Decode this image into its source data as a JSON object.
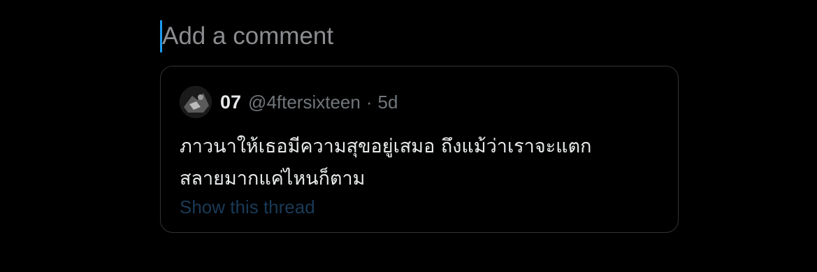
{
  "compose": {
    "placeholder": "Add a comment",
    "caret_color": "#1d9bf0"
  },
  "quote": {
    "avatar_icon": "user-avatar",
    "display_name": "07",
    "handle": "@4ftersixteen",
    "separator": "·",
    "time": "5d",
    "text_line1": "ภาวนาให้เธอมีความสุขอยู่เสมอ ถึงแม้ว่าเราจะแตก",
    "text_line2": "สลายมากแค่ไหนก็ตาม",
    "show_thread": "Show this thread",
    "colors": {
      "background": "#000000",
      "border": "#2f3336",
      "text": "#e7e9ea",
      "muted": "#71767b",
      "link": "#1a3a56"
    }
  }
}
